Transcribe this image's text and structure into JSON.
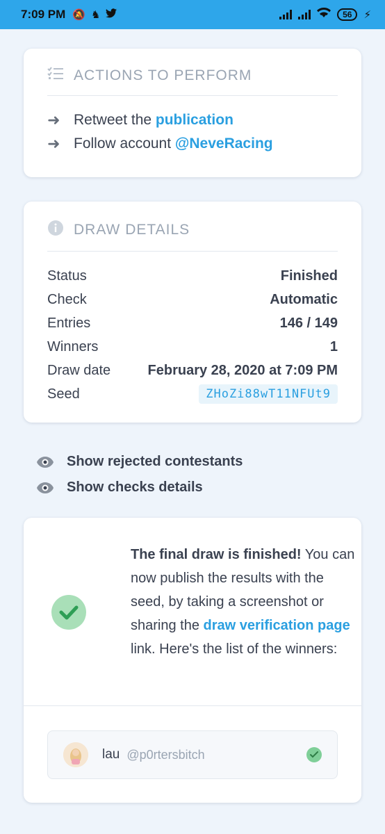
{
  "statusbar": {
    "time": "7:09 PM",
    "battery": "56",
    "icons": [
      "muted-icon",
      "app-icon",
      "twitter-icon",
      "signal-icon",
      "wifi-icon",
      "charging-icon"
    ]
  },
  "actions": {
    "title": "ACTIONS TO PERFORM",
    "items": [
      {
        "text": "Retweet the ",
        "link": "publication"
      },
      {
        "text": "Follow account ",
        "link": "@NeveRacing"
      }
    ]
  },
  "details": {
    "title": "DRAW DETAILS",
    "rows": [
      {
        "label": "Status",
        "value": "Finished"
      },
      {
        "label": "Check",
        "value": "Automatic"
      },
      {
        "label": "Entries",
        "value": "146 / 149"
      },
      {
        "label": "Winners",
        "value": "1"
      },
      {
        "label": "Draw date",
        "value": "February 28, 2020 at 7:09 PM"
      },
      {
        "label": "Seed",
        "value": "ZHoZi88wT11NFUt9"
      }
    ]
  },
  "toggles": {
    "rejected": "Show rejected contestants",
    "checks": "Show checks details"
  },
  "result": {
    "bold": "The final draw is finished!",
    "text1": " You can now publish the results with the seed, by taking a screenshot or sharing the ",
    "link": "draw verification page",
    "text2": " link. Here's the list of the winners:"
  },
  "winner": {
    "name": "lau",
    "handle": "@p0rtersbitch"
  },
  "colors": {
    "accent": "#2a9fe0",
    "statusbar": "#2ea6ea",
    "success": "#7fcf98"
  }
}
